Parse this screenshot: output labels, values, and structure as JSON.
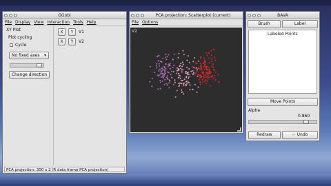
{
  "ggobi": {
    "title": "GGobi",
    "menu": [
      "File",
      "Display",
      "View",
      "Interaction",
      "Tools",
      "Help"
    ],
    "mode_label": "XY Plot",
    "plot_cycling_label": "Plot cycling",
    "cycle_label": "Cycle",
    "axes_select": "No fixed axes",
    "change_direction": "Change direction",
    "var_buttons": [
      {
        "x": "X",
        "y": "Y",
        "name": "V1"
      },
      {
        "x": "X",
        "y": "Y",
        "name": "V2"
      }
    ],
    "status": "PCA projection: 300 x 2 (R data frame PCA projection)"
  },
  "scatter": {
    "title": "PCA projection: Scatterplot (current)",
    "menu": [
      "File",
      "Options"
    ],
    "axis_label": "V2"
  },
  "bava": {
    "title": "BAVA",
    "brush": "Brush",
    "label": "Label",
    "labeled_points": "Labeled Points",
    "move_points": "Move Points",
    "alpha_label": "Alpha",
    "alpha_value": "0.860",
    "alpha_fraction": 0.86,
    "redraw": "Redraw",
    "undo": "Undo"
  },
  "colors": {
    "purple": "#b06ab8",
    "pink": "#e59ab8",
    "red": "#d8262c",
    "plot_bg": "#2d2d2d"
  }
}
